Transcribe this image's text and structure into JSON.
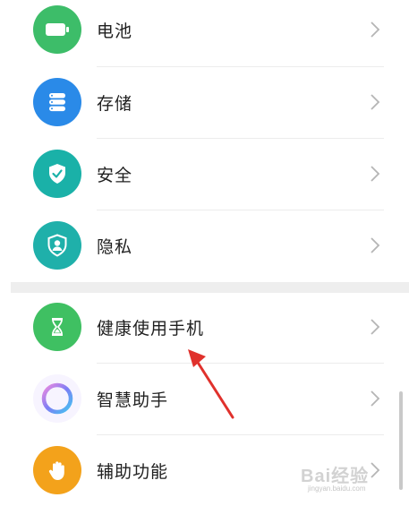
{
  "settings_list": {
    "items": [
      {
        "label": "电池",
        "icon": "battery-icon",
        "icon_color": "#3dbd69"
      },
      {
        "label": "存储",
        "icon": "storage-icon",
        "icon_color": "#2a8ae8"
      },
      {
        "label": "安全",
        "icon": "shield-check-icon",
        "icon_color": "#1ab1a8"
      },
      {
        "label": "隐私",
        "icon": "privacy-icon",
        "icon_color": "#1fb0aa"
      },
      {
        "label": "健康使用手机",
        "icon": "hourglass-icon",
        "icon_color": "#3fc062"
      },
      {
        "label": "智慧助手",
        "icon": "assistant-ring-icon",
        "icon_color": "#8b7ff0"
      },
      {
        "label": "辅助功能",
        "icon": "hand-icon",
        "icon_color": "#f3a21b"
      }
    ]
  },
  "annotation": {
    "arrow_color": "#e0312c",
    "icon": "red-arrow-icon"
  },
  "watermark": {
    "text": "Bai经验",
    "subtext": "jingyan.baidu.com"
  }
}
